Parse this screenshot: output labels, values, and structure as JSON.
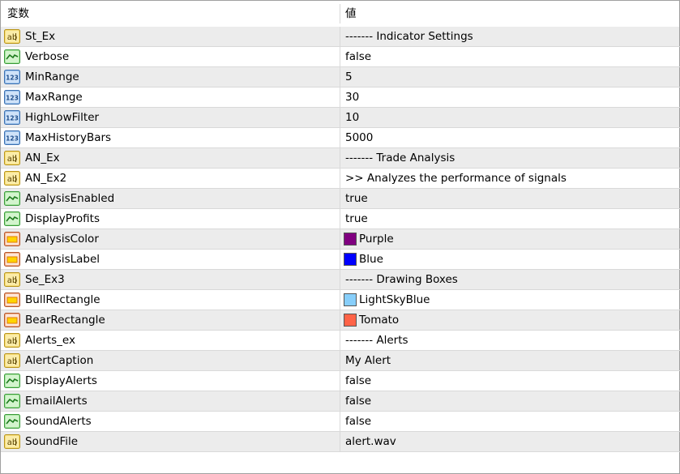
{
  "header": {
    "name_label": "変数",
    "value_label": "値"
  },
  "colors": {
    "Purple": "#800080",
    "Blue": "#0000ff",
    "LightSkyBlue": "#87cefa",
    "Tomato": "#ff6347"
  },
  "rows": [
    {
      "icon": "string-icon",
      "name": "St_Ex",
      "value": "------- Indicator Settings"
    },
    {
      "icon": "bool-icon",
      "name": "Verbose",
      "value": "false"
    },
    {
      "icon": "int-icon",
      "name": "MinRange",
      "value": "5"
    },
    {
      "icon": "int-icon",
      "name": "MaxRange",
      "value": "30"
    },
    {
      "icon": "int-icon",
      "name": "HighLowFilter",
      "value": "10"
    },
    {
      "icon": "int-icon",
      "name": "MaxHistoryBars",
      "value": "5000"
    },
    {
      "icon": "string-icon",
      "name": "AN_Ex",
      "value": "------- Trade Analysis"
    },
    {
      "icon": "string-icon",
      "name": "AN_Ex2",
      "value": ">> Analyzes the performance of signals"
    },
    {
      "icon": "bool-icon",
      "name": "AnalysisEnabled",
      "value": "true"
    },
    {
      "icon": "bool-icon",
      "name": "DisplayProfits",
      "value": "true"
    },
    {
      "icon": "color-icon",
      "name": "AnalysisColor",
      "value": "Purple",
      "swatch": "#800080"
    },
    {
      "icon": "color-icon",
      "name": "AnalysisLabel",
      "value": "Blue",
      "swatch": "#0000ff"
    },
    {
      "icon": "string-icon",
      "name": "Se_Ex3",
      "value": "------- Drawing Boxes"
    },
    {
      "icon": "color-icon",
      "name": "BullRectangle",
      "value": "LightSkyBlue",
      "swatch": "#87cefa"
    },
    {
      "icon": "color-icon",
      "name": "BearRectangle",
      "value": "Tomato",
      "swatch": "#ff6347"
    },
    {
      "icon": "string-icon",
      "name": "Alerts_ex",
      "value": "------- Alerts"
    },
    {
      "icon": "string-icon",
      "name": "AlertCaption",
      "value": "My Alert"
    },
    {
      "icon": "bool-icon",
      "name": "DisplayAlerts",
      "value": "false"
    },
    {
      "icon": "bool-icon",
      "name": "EmailAlerts",
      "value": "false"
    },
    {
      "icon": "bool-icon",
      "name": "SoundAlerts",
      "value": "false"
    },
    {
      "icon": "string-icon",
      "name": "SoundFile",
      "value": "alert.wav"
    }
  ]
}
